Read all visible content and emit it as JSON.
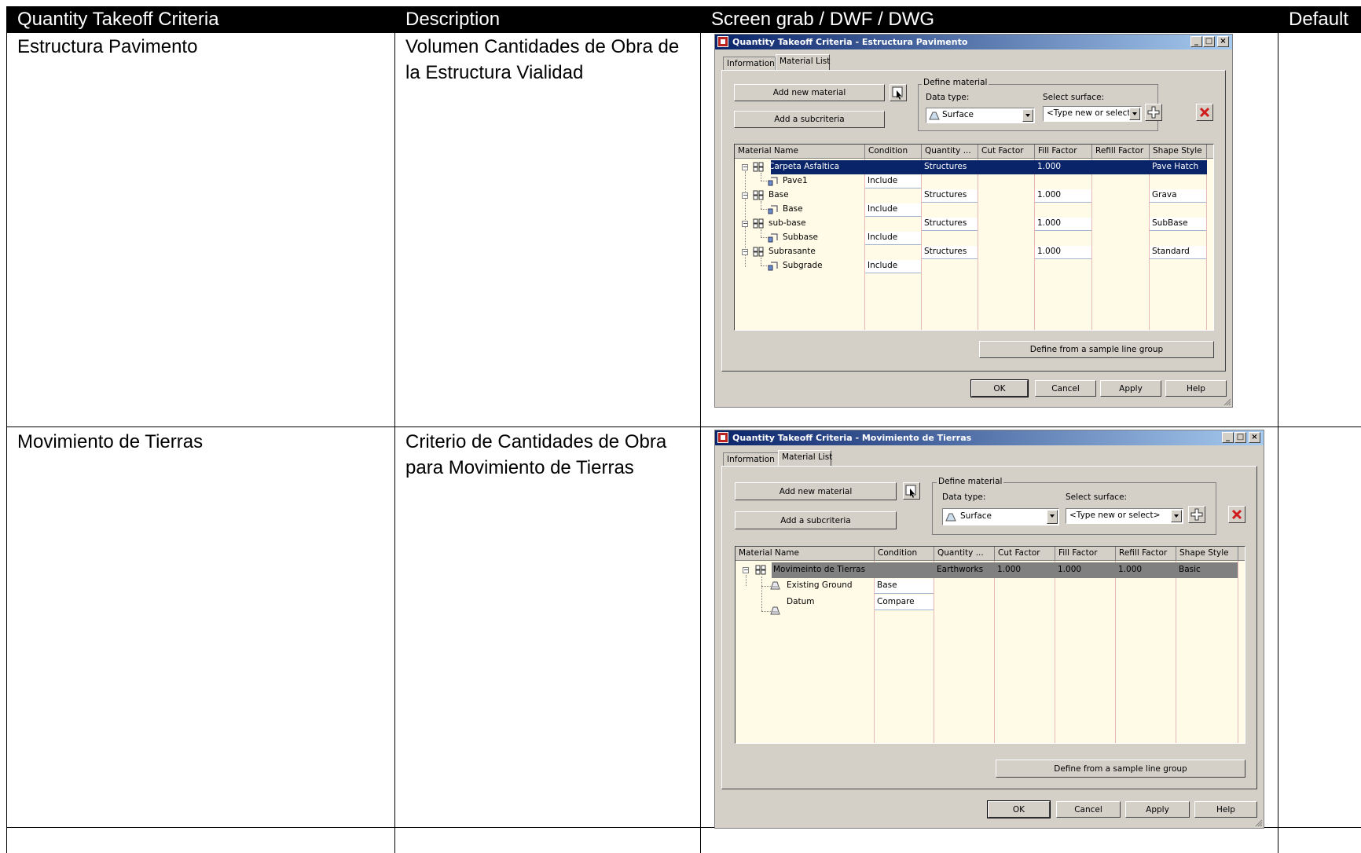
{
  "table": {
    "headers": [
      "Quantity Takeoff Criteria",
      "Description",
      "Screen grab / DWF / DWG",
      "Default"
    ],
    "rows": [
      {
        "criteria": "Estructura Pavimento",
        "description": "Volumen Cantidades de Obra de la Estructura Vialidad"
      },
      {
        "criteria": "Movimiento de Tierras",
        "description": "Criterio de Cantidades de Obra para Movimiento de Tierras"
      }
    ]
  },
  "dialog1": {
    "title": "Quantity Takeoff Criteria - Estructura Pavimento",
    "tabs": [
      "Information",
      "Material List"
    ],
    "add_material": "Add new material",
    "add_subcriteria": "Add a subcriteria",
    "define_material": "Define material",
    "data_type_label": "Data type:",
    "data_type_value": "Surface",
    "select_surface_label": "Select surface:",
    "select_surface_value": "<Type new or select>",
    "columns": [
      "Material Name",
      "Condition",
      "Quantity ...",
      "Cut Factor",
      "Fill Factor",
      "Refill Factor",
      "Shape Style"
    ],
    "rows": [
      {
        "name": "Carpeta Asfaltica",
        "condition": "",
        "quantity": "Structures",
        "cut": "",
        "fill": "1.000",
        "refill": "",
        "shape": "Pave Hatch"
      },
      {
        "name": "Pave1",
        "condition": "Include"
      },
      {
        "name": "Base",
        "condition": "",
        "quantity": "Structures",
        "cut": "",
        "fill": "1.000",
        "refill": "",
        "shape": "Grava"
      },
      {
        "name": "Base",
        "condition": "Include"
      },
      {
        "name": "sub-base",
        "condition": "",
        "quantity": "Structures",
        "cut": "",
        "fill": "1.000",
        "refill": "",
        "shape": "SubBase"
      },
      {
        "name": "Subbase",
        "condition": "Include"
      },
      {
        "name": "Subrasante",
        "condition": "",
        "quantity": "Structures",
        "cut": "",
        "fill": "1.000",
        "refill": "",
        "shape": "Standard"
      },
      {
        "name": "Subgrade",
        "condition": "Include"
      }
    ],
    "define_sample": "Define from a sample line group",
    "ok": "OK",
    "cancel": "Cancel",
    "apply": "Apply",
    "help": "Help"
  },
  "dialog2": {
    "title": "Quantity Takeoff Criteria - Movimiento de Tierras",
    "tabs": [
      "Information",
      "Material List"
    ],
    "add_material": "Add new material",
    "add_subcriteria": "Add a subcriteria",
    "define_material": "Define material",
    "data_type_label": "Data type:",
    "data_type_value": "Surface",
    "select_surface_label": "Select surface:",
    "select_surface_value": "<Type new or select>",
    "columns": [
      "Material Name",
      "Condition",
      "Quantity ...",
      "Cut Factor",
      "Fill Factor",
      "Refill Factor",
      "Shape Style"
    ],
    "rows": [
      {
        "name": "Movimeinto de Tierras",
        "condition": "",
        "quantity": "Earthworks",
        "cut": "1.000",
        "fill": "1.000",
        "refill": "1.000",
        "shape": "Basic"
      },
      {
        "name": "Existing Ground",
        "condition": "Base"
      },
      {
        "name": "Datum",
        "condition": "Compare"
      }
    ],
    "define_sample": "Define from a sample line group",
    "ok": "OK",
    "cancel": "Cancel",
    "apply": "Apply",
    "help": "Help"
  }
}
